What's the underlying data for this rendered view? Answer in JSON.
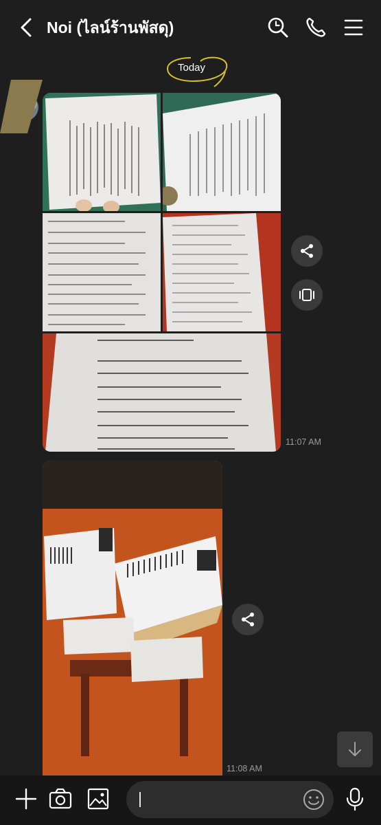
{
  "header": {
    "title": "Noi (ไลน์ร้านพัสดุ)",
    "icons": [
      "back-chevron-icon",
      "search-icon",
      "phone-icon",
      "menu-icon"
    ]
  },
  "chat": {
    "date_label": "Today",
    "messages": [
      {
        "type": "photo-album",
        "photos": [
          {
            "name": "flash-express-receipt-photo-1"
          },
          {
            "name": "flash-express-receipt-photo-2"
          },
          {
            "name": "flash-express-receipt-photo-3"
          },
          {
            "name": "flash-express-receipt-photo-4"
          },
          {
            "name": "flash-express-receipt-photo-5"
          }
        ],
        "time": "11:07 AM",
        "actions": [
          "share-icon",
          "album-icon"
        ]
      },
      {
        "type": "photo",
        "photos": [
          {
            "name": "stacked-parcels-photo"
          }
        ],
        "time": "11:08 AM",
        "actions": [
          "share-icon"
        ]
      }
    ]
  },
  "composer": {
    "input_value": "",
    "icons": [
      "plus-icon",
      "camera-icon",
      "image-icon",
      "emoji-icon",
      "microphone-icon"
    ]
  },
  "colors": {
    "background": "#1e1e1e",
    "composer_background": "#161616",
    "input_background": "#2d2d2d",
    "date_ring": "#d8c21f",
    "timestamp": "#9a9a9a"
  }
}
